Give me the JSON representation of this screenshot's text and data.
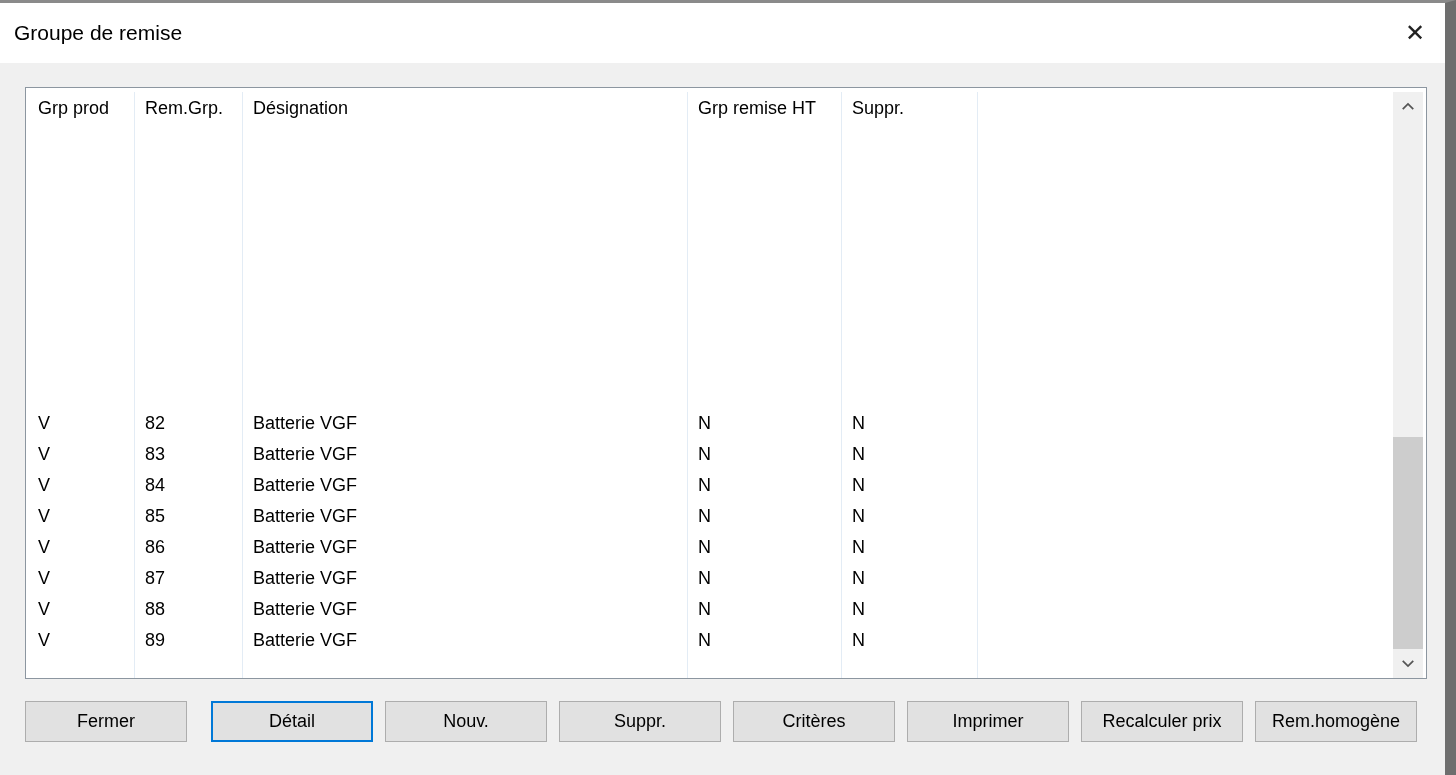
{
  "window": {
    "title": "Groupe de remise",
    "close": "✕"
  },
  "table": {
    "columns": [
      "Grp prod",
      "Rem.Grp.",
      "Désignation",
      "Grp remise HT",
      "Suppr."
    ],
    "rows": [
      {
        "cells": [
          "V",
          "82",
          "Batterie VGF",
          "N",
          "N"
        ]
      },
      {
        "cells": [
          "V",
          "83",
          "Batterie VGF",
          "N",
          "N"
        ]
      },
      {
        "cells": [
          "V",
          "84",
          "Batterie VGF",
          "N",
          "N"
        ]
      },
      {
        "cells": [
          "V",
          "85",
          "Batterie VGF",
          "N",
          "N"
        ]
      },
      {
        "cells": [
          "V",
          "86",
          "Batterie VGF",
          "N",
          "N"
        ]
      },
      {
        "cells": [
          "V",
          "87",
          "Batterie VGF",
          "N",
          "N"
        ]
      },
      {
        "cells": [
          "V",
          "88",
          "Batterie VGF",
          "N",
          "N"
        ]
      },
      {
        "cells": [
          "V",
          "89",
          "Batterie VGF",
          "N",
          "N"
        ]
      }
    ]
  },
  "buttons": [
    {
      "label": "Fermer",
      "focused": false
    },
    {
      "label": "Détail",
      "focused": true
    },
    {
      "label": "Nouv.",
      "focused": false
    },
    {
      "label": "Suppr.",
      "focused": false
    },
    {
      "label": "Critères",
      "focused": false
    },
    {
      "label": "Imprimer",
      "focused": false
    },
    {
      "label": "Recalculer prix",
      "focused": false
    },
    {
      "label": "Rem.homogène",
      "focused": false
    }
  ]
}
